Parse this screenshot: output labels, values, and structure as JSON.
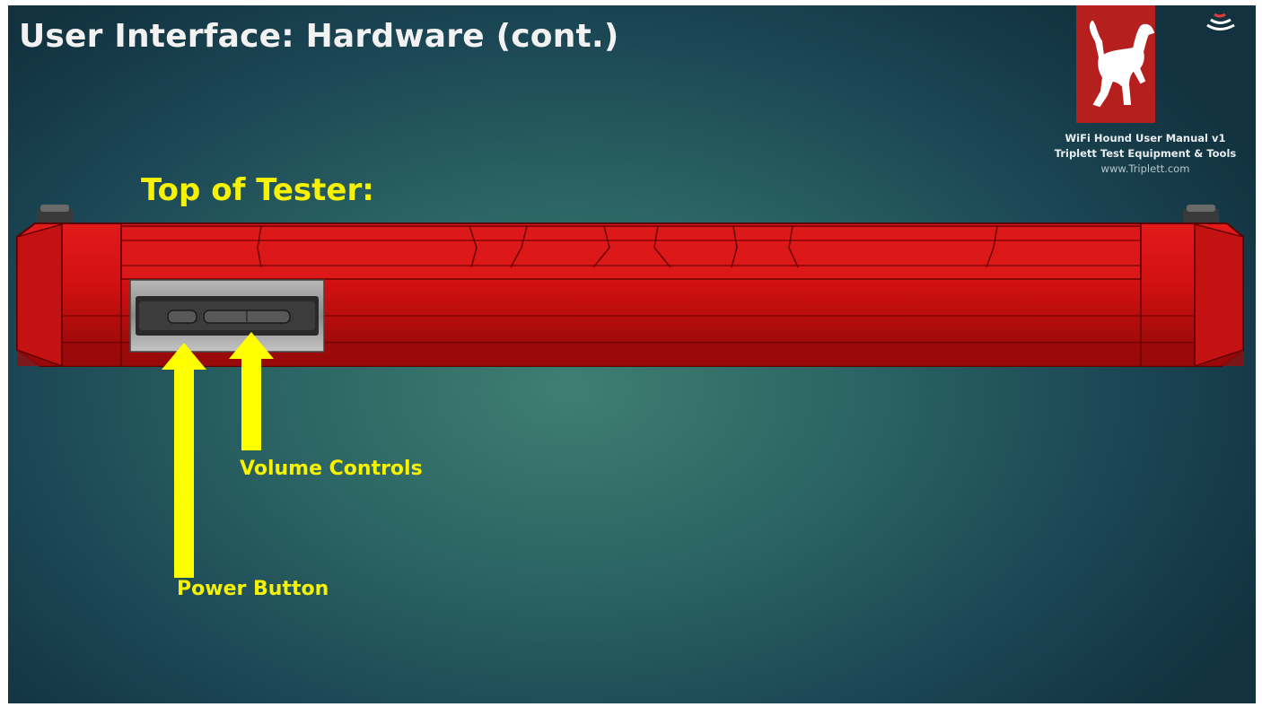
{
  "slide": {
    "title": "User Interface: Hardware (cont.)",
    "subtitle": "Top of Tester:"
  },
  "brand": {
    "line1": "WiFi Hound User Manual v1",
    "line2": "Triplett Test Equipment & Tools",
    "url": "www.Triplett.com",
    "logo_icon": "hound-dog-icon",
    "logo_color": "#b5201e"
  },
  "callouts": {
    "volume": "Volume Controls",
    "power": "Power Button",
    "arrow_color": "#ffff00"
  },
  "device": {
    "body_color": "#d81414"
  }
}
